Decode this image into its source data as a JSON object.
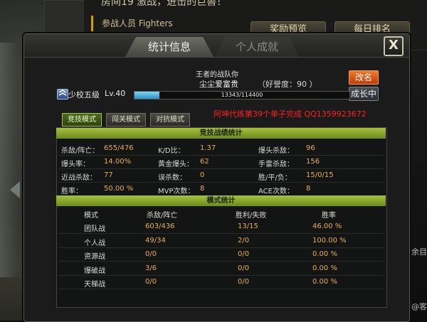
{
  "background": {
    "room_text": "房间19  激战，进击的巨兽！",
    "participants_label": "参战人员 Fighters",
    "reward_preview_button": "奖励预览",
    "daily_rank_button": "每日排名",
    "right_side_text_1": "剩余目",
    "right_side_text_2": "完面@客"
  },
  "dialog": {
    "tabs": [
      "统计信息",
      "个人成就"
    ],
    "close_label": "X",
    "team_name": "王者的战队你",
    "nickname": "尘尘爱富贵",
    "reputation": "（好誉度：90    ）",
    "rename_button": "改名",
    "growth_button": "成长中",
    "rank_name": "少校五级",
    "level": "Lv.40",
    "xp_text": "13343/114400",
    "xp_fraction": 0.1166,
    "mode_buttons": [
      "竞技模式",
      "闯关模式",
      "对抗模式"
    ],
    "promo_text": "阿坤代练第39个单子完成 QQ1359923672"
  },
  "competitive": {
    "header": "竞技战绩统计",
    "rows": [
      [
        {
          "label": "杀敌/阵亡：",
          "value": "655/476"
        },
        {
          "label": "K/D比：",
          "value": "1.37"
        },
        {
          "label": "爆头杀敌：",
          "value": "96"
        }
      ],
      [
        {
          "label": "爆头率：",
          "value": "14.00%"
        },
        {
          "label": "黄金爆头：",
          "value": "62"
        },
        {
          "label": "手雷杀敌：",
          "value": "156"
        }
      ],
      [
        {
          "label": "近战杀敌：",
          "value": "77"
        },
        {
          "label": "误杀数：",
          "value": "0"
        },
        {
          "label": "胜/平/负：",
          "value": "15/0/15"
        }
      ],
      [
        {
          "label": "胜率：",
          "value": "50.00 %"
        },
        {
          "label": "MVP次数：",
          "value": "8"
        },
        {
          "label": "ACE次数：",
          "value": "8"
        }
      ]
    ]
  },
  "mode_stats": {
    "header": "模式统计",
    "columns": [
      "模式",
      "杀敌/阵亡",
      "胜利/失败",
      "胜率"
    ],
    "rows": [
      [
        "团队战",
        "603/436",
        "13/15",
        "46.00 %"
      ],
      [
        "个人战",
        "49/34",
        "2/0",
        "100.00 %"
      ],
      [
        "资源战",
        "0/0",
        "0/0",
        "0.00 %"
      ],
      [
        "爆破战",
        "3/6",
        "0/0",
        "0.00 %"
      ],
      [
        "天梯战",
        "0/0",
        "0/0",
        "0.00 %"
      ]
    ]
  }
}
